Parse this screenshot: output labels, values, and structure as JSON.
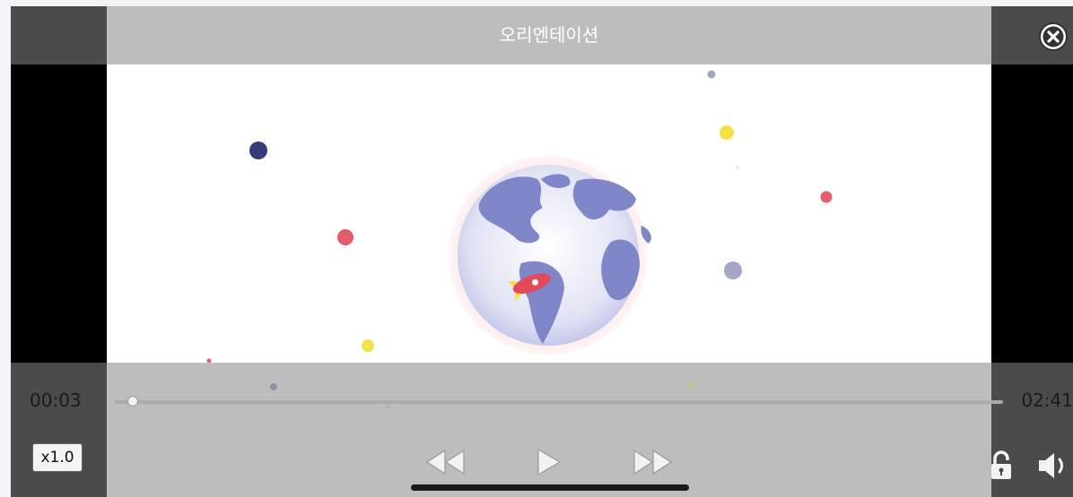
{
  "title": "오리엔테이션",
  "player": {
    "current_time": "00:03",
    "duration": "02:41",
    "speed_label": "x1.0",
    "progress": 0.02
  },
  "icons": {
    "close": "close-circle-icon",
    "rewind": "rewind-icon",
    "play": "play-icon",
    "fast_forward": "fast-forward-icon",
    "lock": "lock-open-icon",
    "volume": "volume-icon"
  },
  "colors": {
    "bar_gray": "#bdbdbd",
    "side_dark": "#4b4b4b",
    "video_bg": "#ffffff",
    "globe": "#7f87c8",
    "rocket": "#e24a5c"
  }
}
